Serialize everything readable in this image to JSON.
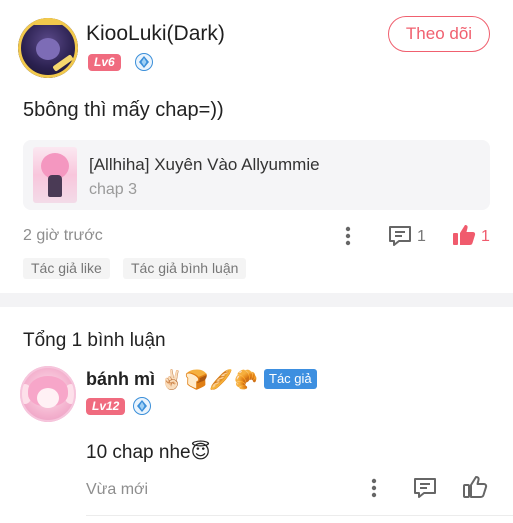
{
  "post": {
    "username": "KiooLuki(Dark)",
    "level": "Lv6",
    "follow_label": "Theo dõi",
    "text": "5bông thì mấy chap=))",
    "story": {
      "title": "[Allhiha] Xuyên Vào Allyummie",
      "chapter": "chap 3"
    },
    "time": "2 giờ trước",
    "comment_count": "1",
    "like_count": "1",
    "tags": [
      "Tác giả like",
      "Tác giả bình luận"
    ]
  },
  "comments": {
    "total_label": "Tổng 1 bình luận",
    "items": [
      {
        "username": "bánh mì",
        "username_emoji": "✌🏻🍞🥖🥐",
        "author_badge": "Tác giả",
        "level": "Lv12",
        "text": "10 chap nhe",
        "text_emoji": "😇",
        "time": "Vừa mới"
      }
    ]
  },
  "colors": {
    "accent_pink": "#f0606f",
    "level_badge": "#f06b7f",
    "author_badge": "#3d8fe0",
    "muted_text": "#8e8e8e"
  },
  "icons": {
    "more": "more-vertical-icon",
    "comment": "comment-icon",
    "like": "thumbs-up-icon",
    "verified": "diamond-badge-icon"
  }
}
